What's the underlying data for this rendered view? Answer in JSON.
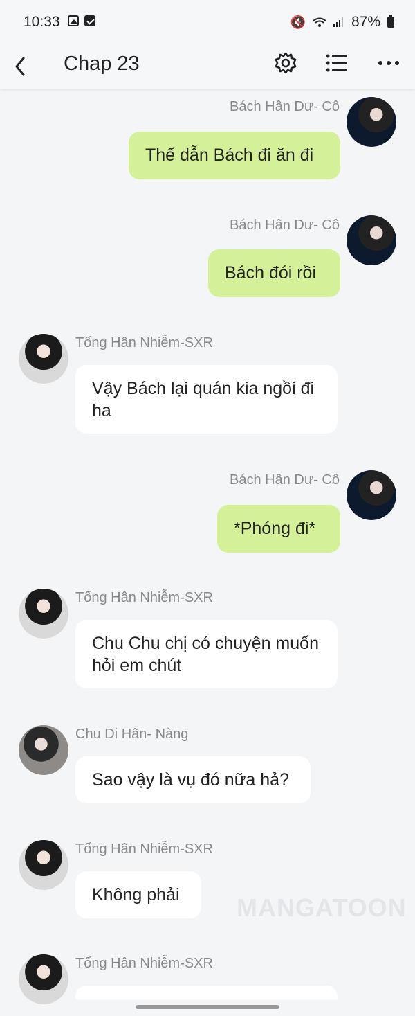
{
  "status_bar": {
    "time": "10:33",
    "battery": "87%"
  },
  "header": {
    "title": "Chap 23",
    "back_icon": "chevron-left-icon",
    "settings_icon": "gear-icon",
    "list_icon": "list-icon",
    "more_icon": "more-horizontal-icon"
  },
  "messages": [
    {
      "sender": "Bách Hân Dư- Cô",
      "text": "Thế dẫn Bách đi ăn đi",
      "side": "right"
    },
    {
      "sender": "Bách Hân Dư- Cô",
      "text": "Bách đói rồi",
      "side": "right"
    },
    {
      "sender": "Tống Hân Nhiễm-SXR",
      "text": "Vậy Bách lại quán kia ngồi đi ha",
      "side": "left"
    },
    {
      "sender": "Bách Hân Dư- Cô",
      "text": "*Phóng đi*",
      "side": "right"
    },
    {
      "sender": "Tống Hân Nhiễm-SXR",
      "text": "Chu Chu chị có chuyện muốn hỏi em chút",
      "side": "left"
    },
    {
      "sender": "Chu Di Hân- Nàng",
      "text": "Sao vậy là vụ đó nữa hả?",
      "side": "left"
    },
    {
      "sender": "Tống Hân Nhiễm-SXR",
      "text": "Không phải",
      "side": "left"
    },
    {
      "sender": "Tống Hân Nhiễm-SXR",
      "text": "",
      "side": "left"
    }
  ],
  "watermark": "MANGATOON",
  "colors": {
    "background": "#f4f5f7",
    "bubble_self": "#d4f19a",
    "bubble_other": "#ffffff",
    "sender": "#8a8a8a"
  }
}
